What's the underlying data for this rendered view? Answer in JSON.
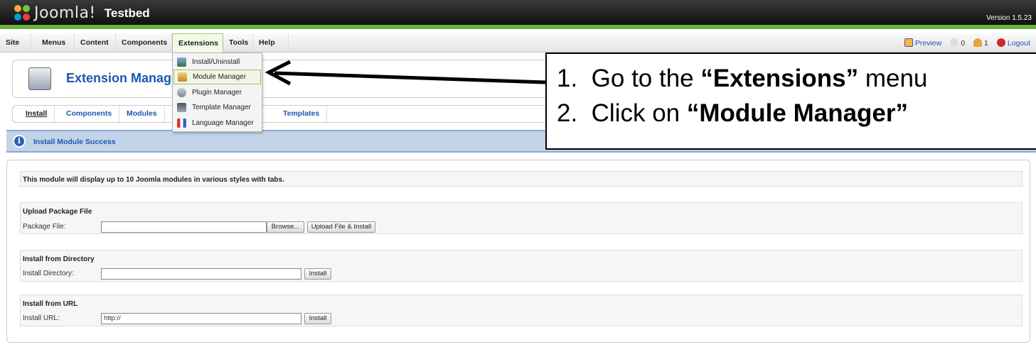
{
  "header": {
    "brand": "Joomla!",
    "site_name": "Testbed",
    "version": "Version 1.5.23"
  },
  "menubar": {
    "items": [
      "Site",
      "Menus",
      "Content",
      "Components",
      "Extensions",
      "Tools",
      "Help"
    ],
    "right": {
      "preview": "Preview",
      "messages_count": "0",
      "users_count": "1",
      "logout": "Logout"
    }
  },
  "dropdown": {
    "items": [
      "Install/Uninstall",
      "Module Manager",
      "Plugin Manager",
      "Template Manager",
      "Language Manager"
    ]
  },
  "toolbar": {
    "title": "Extension Manage"
  },
  "subtabs": [
    "Install",
    "Components",
    "Modules",
    "Templates"
  ],
  "message": {
    "text": "Install Module Success"
  },
  "main": {
    "description": "This module will display up to 10 Joomla modules in various styles with tabs.",
    "upload": {
      "title": "Upload Package File",
      "label": "Package File:",
      "browse": "Browse...",
      "submit": "Upload File & Install"
    },
    "directory": {
      "title": "Install from Directory",
      "label": "Install Directory:",
      "value": "",
      "submit": "Install"
    },
    "url": {
      "title": "Install from URL",
      "label": "Install URL:",
      "value": "http://",
      "submit": "Install"
    }
  },
  "annotation": {
    "step1_num": "1.",
    "step1_pre": "Go to the ",
    "step1_bold": "“Extensions”",
    "step1_post": " menu",
    "step2_num": "2.",
    "step2_pre": "Click on ",
    "step2_bold": "“Module Manager”"
  },
  "colors": {
    "accent_green": "#6cb33f",
    "link_blue": "#1b57b1",
    "message_bg": "#c3d3e8"
  }
}
